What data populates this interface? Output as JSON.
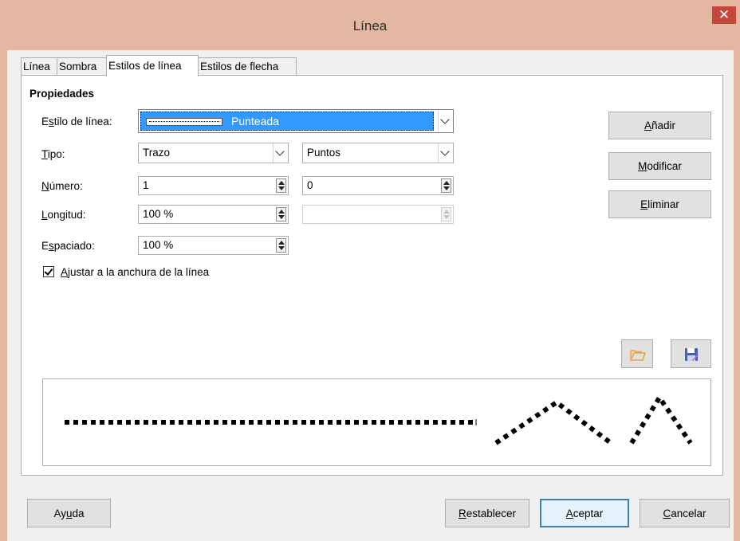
{
  "window": {
    "title": "Línea",
    "close_glyph": "✕"
  },
  "tabs": [
    {
      "label": "Línea",
      "active": false
    },
    {
      "label": "Sombra",
      "active": false
    },
    {
      "label": "Estilos de línea",
      "active": true
    },
    {
      "label": "Estilos de flecha",
      "active": false
    }
  ],
  "properties": {
    "heading": "Propiedades",
    "line_style": {
      "label": "Estilo de línea:",
      "value": "Punteada"
    },
    "type": {
      "label": "Tipo:",
      "value1": "Trazo",
      "value2": "Puntos"
    },
    "number": {
      "label": "Número:",
      "value1": "1",
      "value2": "0"
    },
    "length": {
      "label": "Longitud:",
      "value1": "100 %",
      "value2": ""
    },
    "spacing": {
      "label": "Espaciado:",
      "value1": "100 %"
    },
    "fit_checkbox": {
      "label": "Ajustar a la anchura de la línea",
      "checked": true
    }
  },
  "side_buttons": {
    "add": "Añadir",
    "modify": "Modificar",
    "delete": "Eliminar"
  },
  "icons": {
    "open": "folder-open-icon",
    "save": "save-icon"
  },
  "footer": {
    "help": "Ayuda",
    "reset": "Restablecer",
    "ok": "Aceptar",
    "cancel": "Cancelar"
  },
  "colors": {
    "titlebar": "#e3b7a2",
    "close": "#c7463a",
    "selection": "#3399ff",
    "icon_orange": "#e8a23a",
    "icon_blue": "#3a63c4"
  }
}
